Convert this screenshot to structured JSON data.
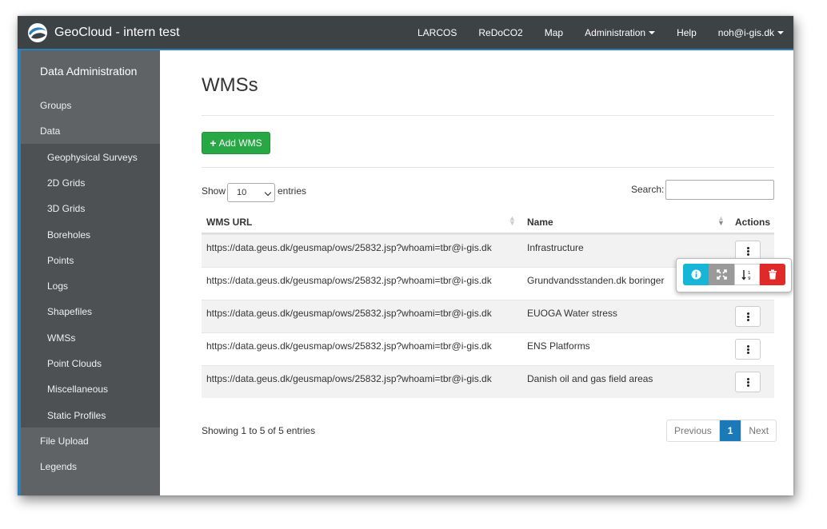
{
  "navbar": {
    "brand": "GeoCloud - intern test",
    "links": [
      "LARCOS",
      "ReDoCO2",
      "Map",
      "Administration",
      "Help",
      "noh@i-gis.dk"
    ]
  },
  "sidebar": {
    "title": "Data Administration",
    "items": [
      "Groups",
      "Data"
    ],
    "data_sub_items": [
      "Geophysical Surveys",
      "2D Grids",
      "3D Grids",
      "Boreholes",
      "Points",
      "Logs",
      "Shapefiles",
      "WMSs",
      "Point Clouds",
      "Miscellaneous",
      "Static Profiles"
    ],
    "bottom_items": [
      "File Upload",
      "Legends"
    ]
  },
  "page": {
    "title": "WMSs",
    "add_button": "Add WMS",
    "show_label": "Show",
    "entries_value": "10",
    "entries_label": "entries",
    "search_label": "Search:"
  },
  "table": {
    "headers": [
      "WMS URL",
      "Name",
      "Actions"
    ],
    "rows": [
      {
        "url": "https://data.geus.dk/geusmap/ows/25832.jsp?whoami=tbr@i-gis.dk",
        "name": "Infrastructure"
      },
      {
        "url": "https://data.geus.dk/geusmap/ows/25832.jsp?whoami=tbr@i-gis.dk",
        "name": "Grundvandsstanden.dk boringer"
      },
      {
        "url": "https://data.geus.dk/geusmap/ows/25832.jsp?whoami=tbr@i-gis.dk",
        "name": "EUOGA Water stress"
      },
      {
        "url": "https://data.geus.dk/geusmap/ows/25832.jsp?whoami=tbr@i-gis.dk",
        "name": "ENS Platforms"
      },
      {
        "url": "https://data.geus.dk/geusmap/ows/25832.jsp?whoami=tbr@i-gis.dk",
        "name": "Danish oil and gas field areas"
      }
    ]
  },
  "actions_popover": {
    "icons": [
      "info-icon",
      "expand-icon",
      "sort-numeric-icon",
      "trash-icon"
    ]
  },
  "footer": {
    "showing": "Showing 1 to 5 of 5 entries",
    "previous": "Previous",
    "current_page": "1",
    "next": "Next"
  },
  "colors": {
    "navbar": "#3d4244",
    "sidebar": "#5f6365",
    "accent": "#2c7fb8",
    "add_button": "#28a745",
    "info": "#17b5d6",
    "danger": "#e02a2a",
    "page_active": "#1b79b8"
  }
}
